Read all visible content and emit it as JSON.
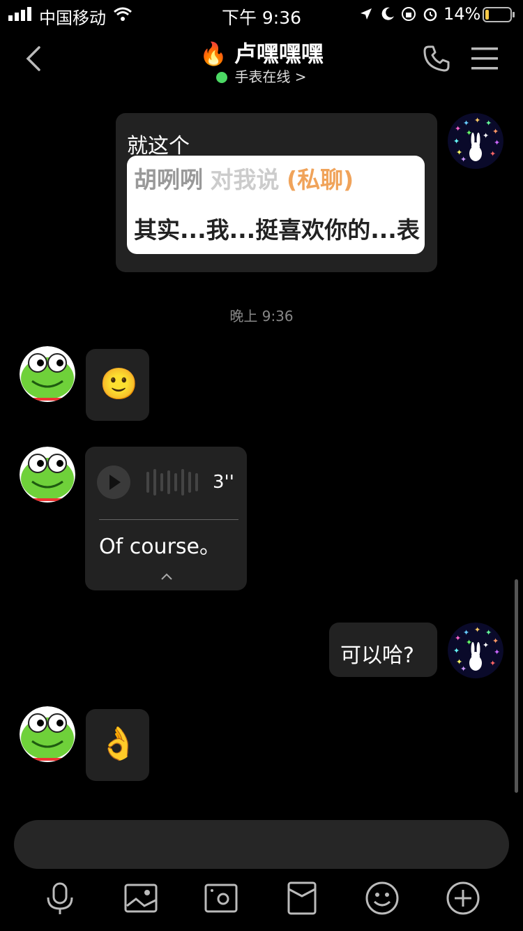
{
  "status_bar": {
    "carrier": "中国移动",
    "time": "下午 9:36",
    "battery_percent": "14%"
  },
  "header": {
    "title": "卢嘿嘿嘿",
    "subtitle": "手表在线 >",
    "flame_icon": "🔥"
  },
  "messages": {
    "m1_text": "就这个",
    "m1_card_sender": "胡咧咧",
    "m1_card_action": "对我说",
    "m1_card_tag": "(私聊)",
    "m1_card_body": "其实...我...挺喜欢你的...表",
    "timestamp": "晚上 9:36",
    "m2_emoji": "🙂",
    "m3_duration": "3''",
    "m3_transcript": "Of course。",
    "m4_text": "可以哈?",
    "m5_emoji": "👌"
  },
  "colors": {
    "online": "#4cd964",
    "bubble": "#222222",
    "accent_orange": "#f0a35a"
  }
}
